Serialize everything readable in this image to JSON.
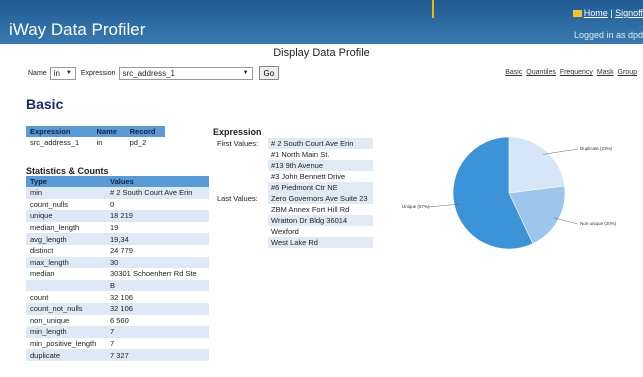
{
  "app": {
    "title": "iWay Data Profiler",
    "home_link": "Home",
    "separator": "|",
    "signoff_link": "Signoff",
    "logged_in_text": "Logged in as dpd"
  },
  "page_heading": "Display Data Profile",
  "toolbar": {
    "name_label": "Name",
    "name_value": "in",
    "expression_label": "Expression",
    "expression_value": "src_address_1",
    "go_label": "Go"
  },
  "view_links": [
    "Basic",
    "Quantiles",
    "Frequency",
    "Mask",
    "Group"
  ],
  "section_title": "Basic",
  "expression_table": {
    "headers": [
      "Expression",
      "Name",
      "Record"
    ],
    "row": [
      "src_address_1",
      "in",
      "pd_2"
    ]
  },
  "stats": {
    "title": "Statistics & Counts",
    "headers": [
      "Type",
      "Values"
    ],
    "rows": [
      [
        "min",
        "# 2 South Court Ave Erin"
      ],
      [
        "count_nulls",
        "0"
      ],
      [
        "unique",
        "18 219"
      ],
      [
        "median_length",
        "19"
      ],
      [
        "avg_length",
        "19,34"
      ],
      [
        "distinct",
        "24 779"
      ],
      [
        "max_length",
        "30"
      ],
      [
        "median",
        "30301 Schoenherr Rd Ste"
      ],
      [
        "",
        "B"
      ],
      [
        "count",
        "32 106"
      ],
      [
        "count_not_nulls",
        "32 106"
      ],
      [
        "non_unique",
        "6 560"
      ],
      [
        "min_length",
        "7"
      ],
      [
        "min_positive_length",
        "7"
      ],
      [
        "duplicate",
        "7 327"
      ]
    ]
  },
  "expression_panel": {
    "title": "Expression",
    "first_label": "First Values:",
    "first_values": [
      "# 2 South Court Ave Erin",
      "#1 North Main St.",
      "#13 9th Avenue",
      "#3 John Bennett Drive",
      "#6 Piedmont Ctr NE"
    ],
    "last_label": "Last Values:",
    "last_values": [
      "Zero Governors Ave Suite 23",
      "ZBM Annex Fort Hill Rd",
      "Wratton Dr Bldg 36014",
      "Wexford",
      "West Lake Rd"
    ]
  },
  "chart_data": {
    "type": "pie",
    "slices": [
      {
        "label": "Duplicate (23%)",
        "value": 23,
        "color": "#d6e6f6"
      },
      {
        "label": "Non unique (20%)",
        "value": 20,
        "color": "#9cc6ec"
      },
      {
        "label": "Unique (57%)",
        "value": 57,
        "color": "#3d93d8"
      }
    ]
  }
}
